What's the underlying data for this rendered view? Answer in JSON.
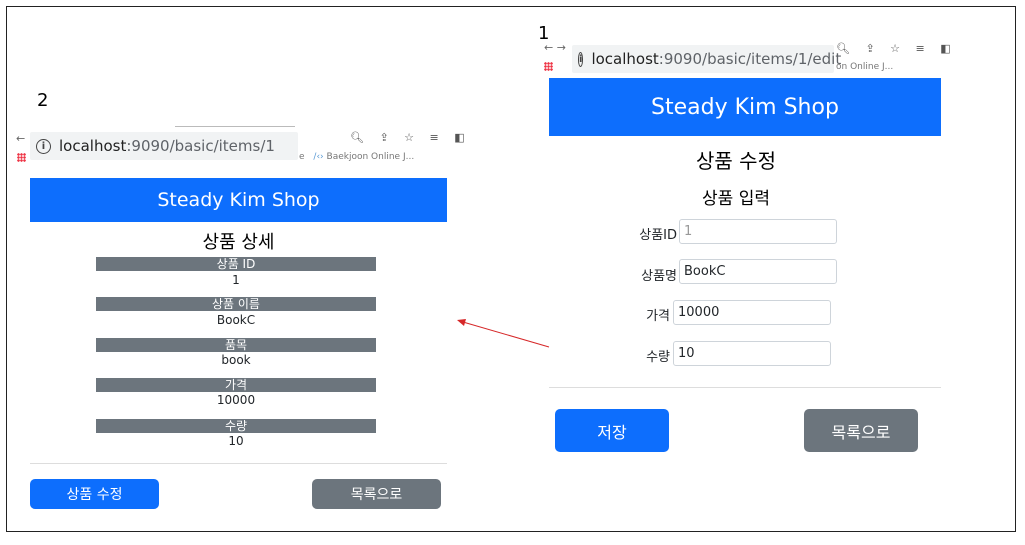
{
  "labels": {
    "left": "2",
    "right": "1"
  },
  "panel_right": {
    "url_host": "localhost",
    "url_path": ":9090/basic/items/1/edit",
    "bookmark_text": "on Online J...",
    "shop_title": "Steady Kim Shop",
    "page_title": "상품 수정",
    "section_title": "상품 입력",
    "fields": [
      {
        "label": "상품ID",
        "value": "1"
      },
      {
        "label": "상품명",
        "value": "BookC"
      },
      {
        "label": "가격",
        "value": "10000"
      },
      {
        "label": "수량",
        "value": "10"
      }
    ],
    "save_label": "저장",
    "list_label": "목록으로"
  },
  "panel_left": {
    "url_host": "localhost",
    "url_path": ":9090/basic/items/1",
    "bookmark_text": "Baekjoon Online J...",
    "bookmark_prefix": "e",
    "shop_title": "Steady Kim Shop",
    "page_title": "상품 상세",
    "fields": [
      {
        "label": "상품 ID",
        "value": "1"
      },
      {
        "label": "상품 이름",
        "value": "BookC"
      },
      {
        "label": "품목",
        "value": "book"
      },
      {
        "label": "가격",
        "value": "10000"
      },
      {
        "label": "수량",
        "value": "10"
      }
    ],
    "edit_label": "상품 수정",
    "list_label": "목록으로"
  },
  "colors": {
    "primary": "#0d6efd",
    "secondary": "#6c757d",
    "arrow": "#d62728"
  }
}
